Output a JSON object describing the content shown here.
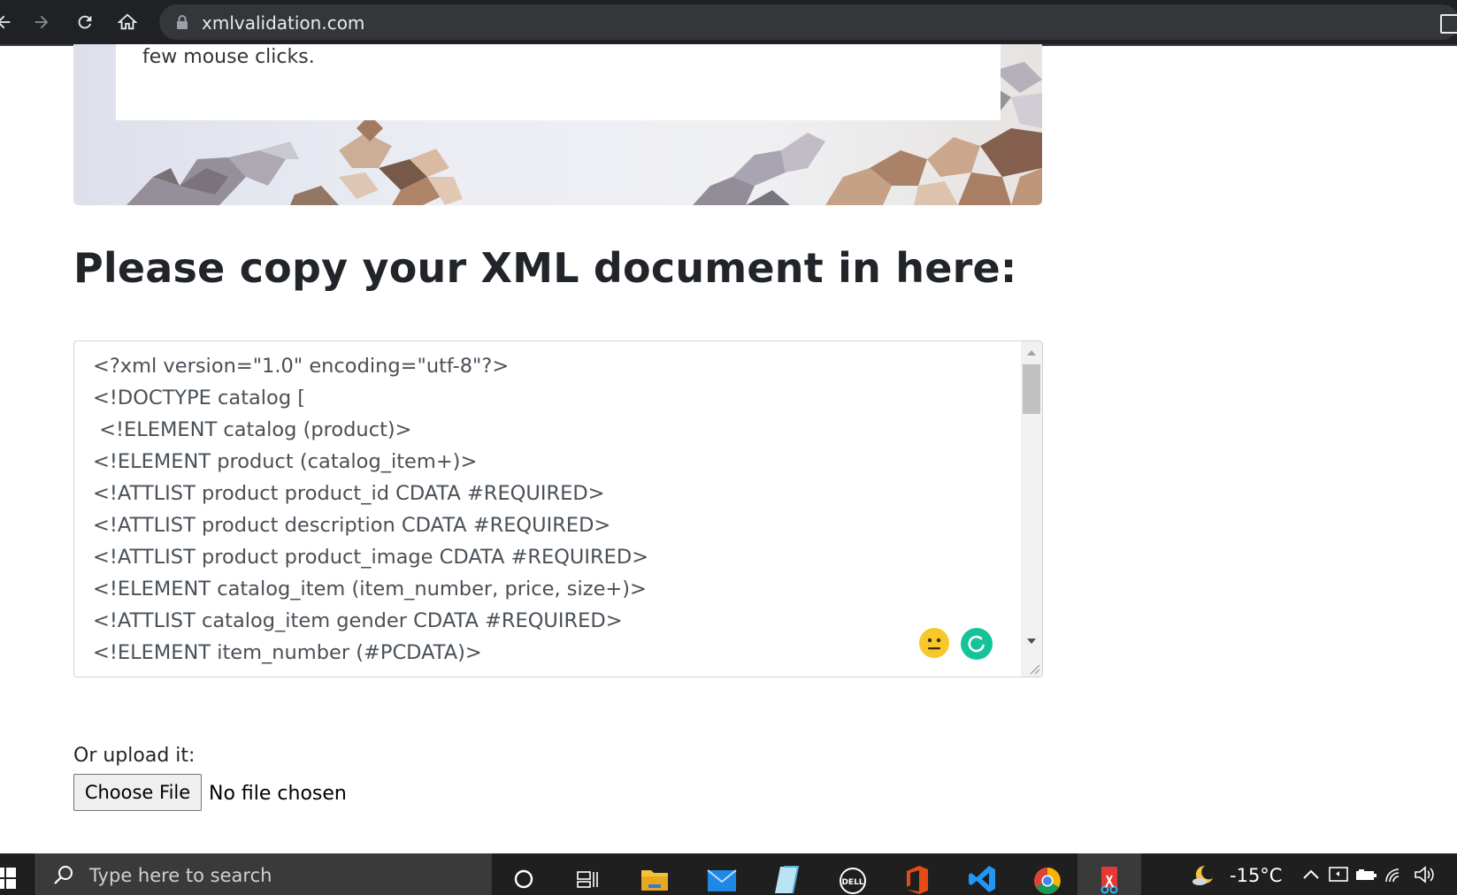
{
  "browser": {
    "url": "xmlvalidation.com"
  },
  "hero": {
    "text": "few mouse clicks."
  },
  "main": {
    "heading": "Please copy your XML document in here:",
    "xml_lines": [
      "<?xml version=\"1.0\" encoding=\"utf-8\"?>",
      "<!DOCTYPE catalog [",
      " <!ELEMENT catalog (product)>",
      "<!ELEMENT product (catalog_item+)>",
      "<!ATTLIST product product_id CDATA #REQUIRED>",
      "<!ATTLIST product description CDATA #REQUIRED>",
      "<!ATTLIST product product_image CDATA #REQUIRED>",
      "<!ELEMENT catalog_item (item_number, price, size+)>",
      "<!ATTLIST catalog_item gender CDATA #REQUIRED>",
      "<!ELEMENT item_number (#PCDATA)>"
    ]
  },
  "upload": {
    "label": "Or upload it:",
    "button_label": "Choose File",
    "status": "No file chosen"
  },
  "taskbar": {
    "search_placeholder": "Type here to search",
    "temperature": "-15°C",
    "apps": [
      "cortana-icon",
      "task-view-icon",
      "file-explorer-icon",
      "mail-icon",
      "notepad-icon",
      "dell-icon",
      "office-icon",
      "vscode-icon",
      "chrome-icon",
      "snip-icon"
    ]
  },
  "colors": {
    "browser_bar": "#202124",
    "heading": "#212529",
    "taskbar": "#1f1f1f",
    "grammarly": "#15c39a"
  }
}
